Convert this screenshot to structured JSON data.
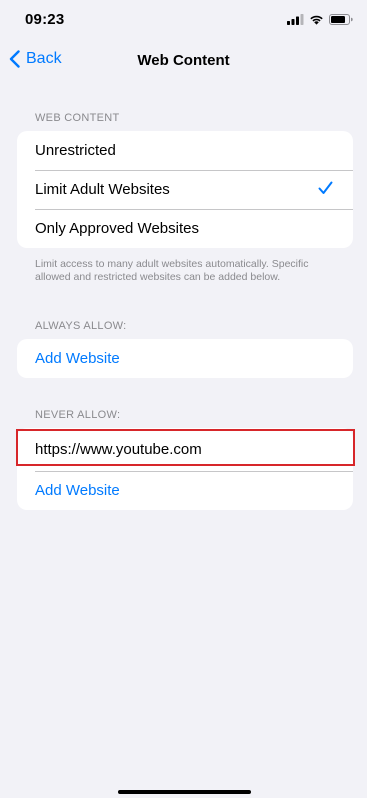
{
  "status_bar": {
    "time": "09:23"
  },
  "nav": {
    "back_label": "Back",
    "title": "Web Content"
  },
  "web_content": {
    "header": "WEB CONTENT",
    "options": [
      {
        "label": "Unrestricted",
        "selected": false
      },
      {
        "label": "Limit Adult Websites",
        "selected": true
      },
      {
        "label": "Only Approved Websites",
        "selected": false
      }
    ],
    "footer": "Limit access to many adult websites automatically. Specific allowed and restricted websites can be added below."
  },
  "always_allow": {
    "header": "ALWAYS ALLOW:",
    "add_label": "Add Website"
  },
  "never_allow": {
    "header": "NEVER ALLOW:",
    "sites": [
      "https://www.youtube.com"
    ],
    "add_label": "Add Website"
  },
  "colors": {
    "accent": "#007aff",
    "background": "#f2f2f7",
    "secondary_text": "#8a8a8e",
    "highlight": "#d7262a"
  }
}
